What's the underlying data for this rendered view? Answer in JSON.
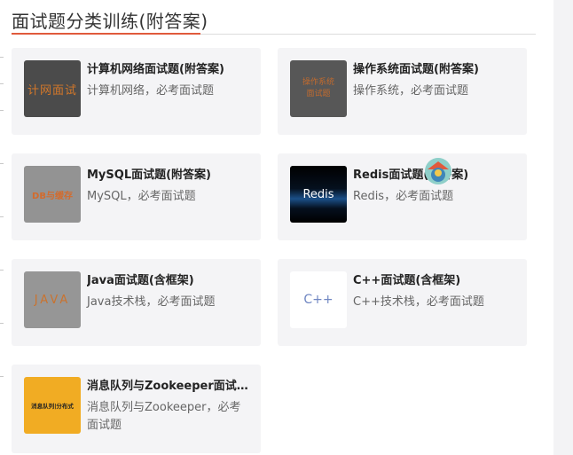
{
  "section": {
    "title": "面试题分类训练(附答案)"
  },
  "colors": {
    "accent": "#e05a3c"
  },
  "cards": [
    {
      "title": "计算机网络面试题(附答案)",
      "desc": "计算机网络，必考面试题",
      "thumb_text": "计网面试"
    },
    {
      "title": "操作系统面试题(附答案)",
      "desc": "操作系统，必考面试题",
      "thumb_text": "操作系统\n面试题"
    },
    {
      "title": "MySQL面试题(附答案)",
      "desc": "MySQL，必考面试题",
      "thumb_text": "DB与缓存"
    },
    {
      "title": "Redis面试题(附答案)",
      "desc": "Redis，必考面试题",
      "thumb_text": "Redis"
    },
    {
      "title": "Java面试题(含框架)",
      "desc": "Java技术栈，必考面试题",
      "thumb_text": "JAVA"
    },
    {
      "title": "C++面试题(含框架)",
      "desc": "C++技术栈，必考面试题",
      "thumb_text": "C++"
    },
    {
      "title": "消息队列与Zookeeper面试题(附答案)",
      "desc": "消息队列与Zookeeper，必考面试题",
      "thumb_text": "消息队列|分布式"
    }
  ]
}
